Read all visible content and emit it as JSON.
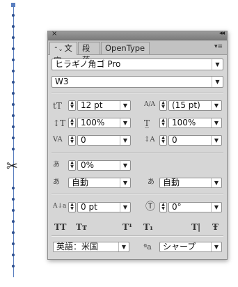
{
  "panel": {
    "close_glyph": "×",
    "collapse_glyph": "◂◂",
    "menu_glyph": "▾≡",
    "tabs": [
      {
        "label": "文字",
        "sort": "⌃⌄"
      },
      {
        "label": "段落"
      },
      {
        "label": "OpenType"
      }
    ]
  },
  "font": {
    "family": "ヒラギノ角ゴ Pro",
    "style": "W3"
  },
  "metrics": {
    "font_size": "12 pt",
    "leading": "(15 pt)",
    "vertical_scale": "100%",
    "horizontal_scale": "100%",
    "kerning": "0",
    "tracking": "0",
    "tsume": "0%",
    "aki_before": "自動",
    "aki_after": "自動",
    "baseline_shift": "0 pt",
    "rotation": "0°"
  },
  "format_buttons": [
    "TT",
    "Tт",
    "T¹",
    "T₁",
    "T|",
    "Ŧ"
  ],
  "language": "英語：米国",
  "antialias": {
    "icon": "ªa",
    "value": "シャープ"
  },
  "icons": {
    "font_size": "tT",
    "leading": "A/A",
    "vertical_scale": "↕T",
    "horizontal_scale": "T̲",
    "kerning": "VA",
    "tracking": "↕A",
    "tsume": "あ",
    "aki_before": "あ",
    "aki_after": "あ",
    "baseline_shift": "A↓a",
    "rotation": "Ⓣ",
    "scissors": "✂"
  }
}
